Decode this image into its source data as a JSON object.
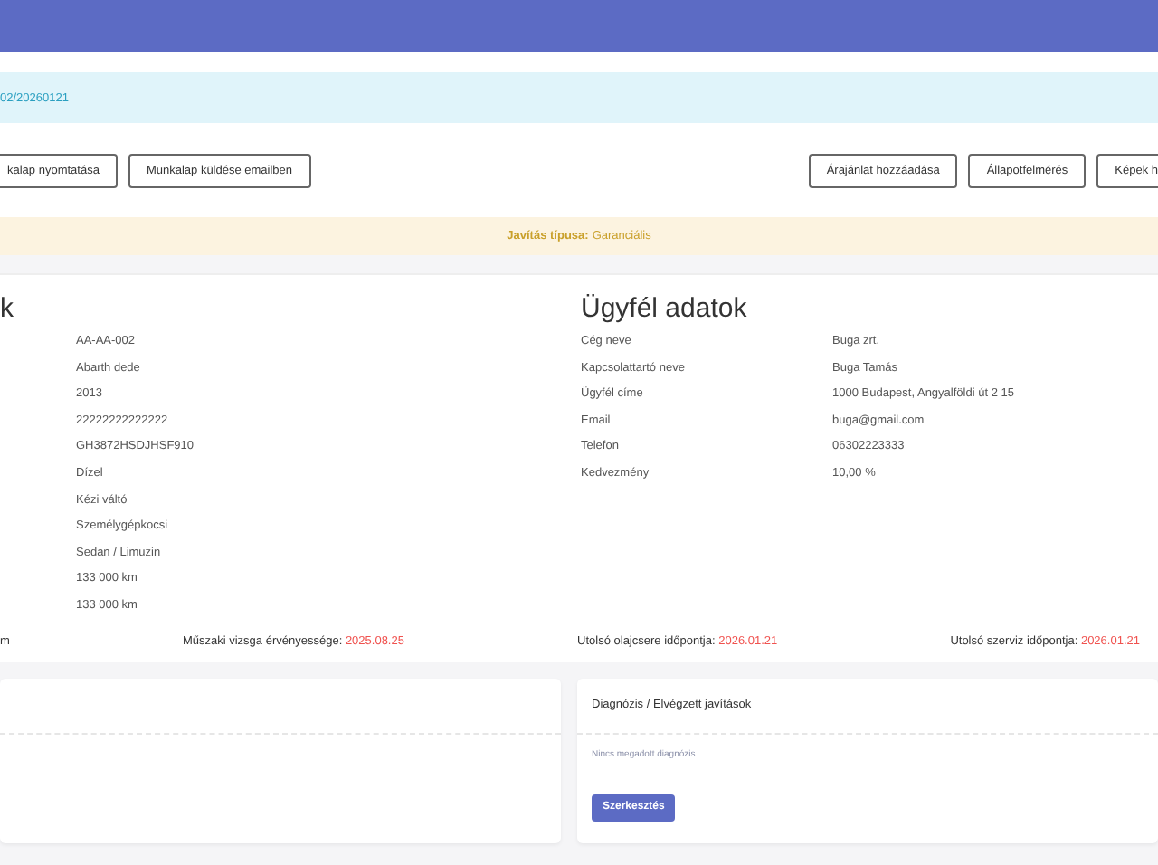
{
  "info_alert": {
    "text": "02/20260121"
  },
  "actions_left": [
    "kalap nyomtatása",
    "Munkalap küldése emailben"
  ],
  "actions_right": [
    "Árajánlat hozzáadása",
    "Állapotfelmérés",
    "Képek h"
  ],
  "repair_type": {
    "label": "Javítás típusa:",
    "value": "Garanciális"
  },
  "vehicle": {
    "title": "k",
    "values": [
      "AA-AA-002",
      "Abarth dede",
      "2013",
      "22222222222222",
      "GH3872HSDJHSF910",
      "Dízel",
      "Kézi váltó",
      "Személygépkocsi",
      "Sedan / Limuzin",
      "133 000 km",
      "133 000 km"
    ]
  },
  "customer": {
    "title": "Ügyfél adatok",
    "rows": [
      {
        "label": "Cég neve",
        "value": "Buga zrt."
      },
      {
        "label": "Kapcsolattartó neve",
        "value": "Buga Tamás"
      },
      {
        "label": "Ügyfél címe",
        "value": "1000 Budapest, Angyalföldi út 2 15"
      },
      {
        "label": "Email",
        "value": "buga@gmail.com"
      },
      {
        "label": "Telefon",
        "value": "06302223333"
      },
      {
        "label": "Kedvezmény",
        "value": "10,00 %"
      }
    ]
  },
  "dates": [
    {
      "label": "m"
    },
    {
      "label": "Műszaki vizsga érvényessége:",
      "value": "2025.08.25"
    },
    {
      "label": "Utolsó olajcsere időpontja:",
      "value": "2026.01.21"
    },
    {
      "label": "Utolsó szerviz időpontja:",
      "value": "2026.01.21"
    }
  ],
  "diagnosis": {
    "title": "Diagnózis / Elvégzett javítások",
    "empty_text": "Nincs megadott diagnózis.",
    "button": "Szerkesztés"
  }
}
